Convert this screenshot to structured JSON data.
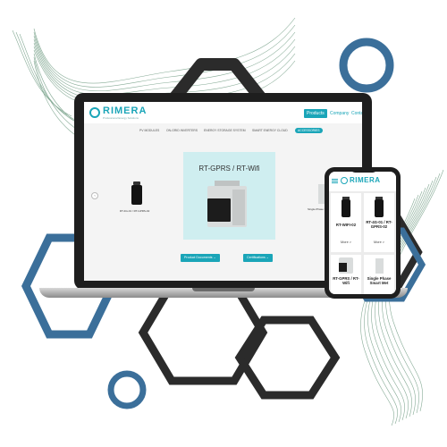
{
  "site": {
    "logo_text": "RIMERA",
    "logo_tagline": "Professional Energy Solutions",
    "header_buttons": [
      "Products",
      "Company",
      "Conta"
    ],
    "subnav": [
      "PV MODULES",
      "ON-GRID INVERTERS",
      "ENERGY STORAGE SYSTEM",
      "SMART ENERGY CLOUD",
      "ACCESSORIES"
    ]
  },
  "laptop": {
    "hero_title": "RT-GPRS / RT-Wifi",
    "left_product_label": "RT-4G-01 / RT-GPRS-02",
    "right_product_label": "Single-Phase S",
    "prev_arrow": "‹",
    "product_documents_button": "Product Documents",
    "certifications_button": "Certifications"
  },
  "phone": {
    "logo_text": "RIMERA",
    "menu_icon": "hamburger-icon",
    "products": [
      {
        "label": "RT-WIFI-02",
        "more": "More >"
      },
      {
        "label": "RT-4G-01 / RT-GPRS-02",
        "more": "More >"
      },
      {
        "label": "RT-GPRS / RT-Wifi",
        "more": ""
      },
      {
        "label": "Single Phase Smart Met",
        "more": ""
      }
    ]
  },
  "colors": {
    "accent": "#1aa5b8",
    "hexagon_blue": "#3b6f9a",
    "hexagon_dark": "#2b2b2b",
    "wave_green": "#5e8f73"
  }
}
